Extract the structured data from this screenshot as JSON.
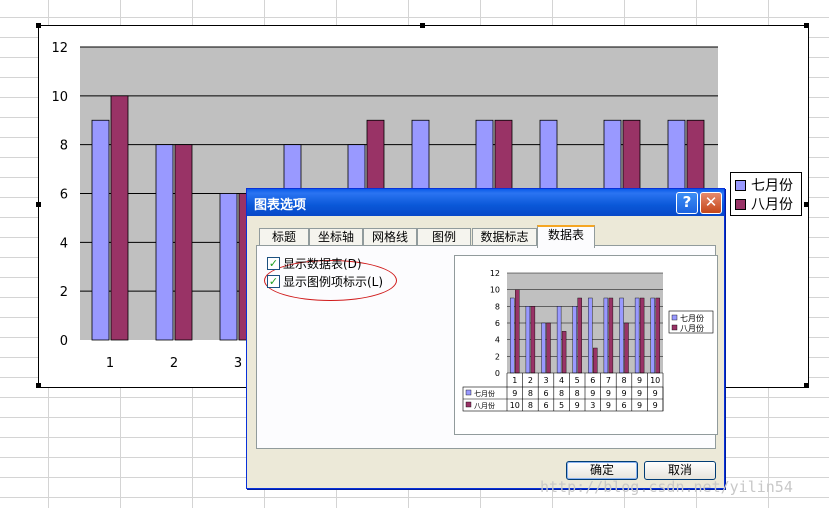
{
  "colors": {
    "series1": "#9999ff",
    "series2": "#993366",
    "plot_bg": "#c0c0c0",
    "dialog_bg": "#ece9d8",
    "titlebar": "#0a58d8"
  },
  "chart_data": {
    "type": "bar",
    "categories": [
      "1",
      "2",
      "3",
      "4",
      "5",
      "6",
      "7",
      "8",
      "9",
      "10"
    ],
    "series": [
      {
        "name": "七月份",
        "values": [
          9,
          8,
          6,
          8,
          8,
          9,
          9,
          9,
          9,
          9
        ]
      },
      {
        "name": "八月份",
        "values": [
          10,
          8,
          6,
          5,
          9,
          3,
          9,
          6,
          9,
          9
        ]
      }
    ],
    "ylim": [
      0,
      12
    ],
    "yticks": [
      "0",
      "2",
      "4",
      "6",
      "8",
      "10",
      "12"
    ],
    "grid": true,
    "legend": "right"
  },
  "preview_chart": {
    "yticks": [
      "0",
      "2",
      "4",
      "6",
      "8",
      "10",
      "12"
    ],
    "categories": [
      "1",
      "2",
      "3",
      "4",
      "5",
      "6",
      "7",
      "8",
      "9",
      "10"
    ],
    "legend_labels": [
      "七月份",
      "八月份"
    ],
    "table_rows": [
      {
        "label": "七月份",
        "values": [
          "9",
          "8",
          "6",
          "8",
          "8",
          "9",
          "9",
          "9",
          "9",
          "9"
        ]
      },
      {
        "label": "八月份",
        "values": [
          "10",
          "8",
          "6",
          "5",
          "9",
          "3",
          "9",
          "6",
          "9",
          "9"
        ]
      }
    ]
  },
  "dialog": {
    "title": "图表选项",
    "help_label": "?",
    "close_label": "✕",
    "tabs": [
      "标题",
      "坐标轴",
      "网格线",
      "图例",
      "数据标志",
      "数据表"
    ],
    "active_tab": "数据表",
    "options": [
      {
        "label": "显示数据表(D)",
        "checked": true
      },
      {
        "label": "显示图例项标示(L)",
        "checked": true
      }
    ],
    "ok_label": "确定",
    "cancel_label": "取消"
  },
  "watermark": "http://blog.csdn.net/yilin54"
}
